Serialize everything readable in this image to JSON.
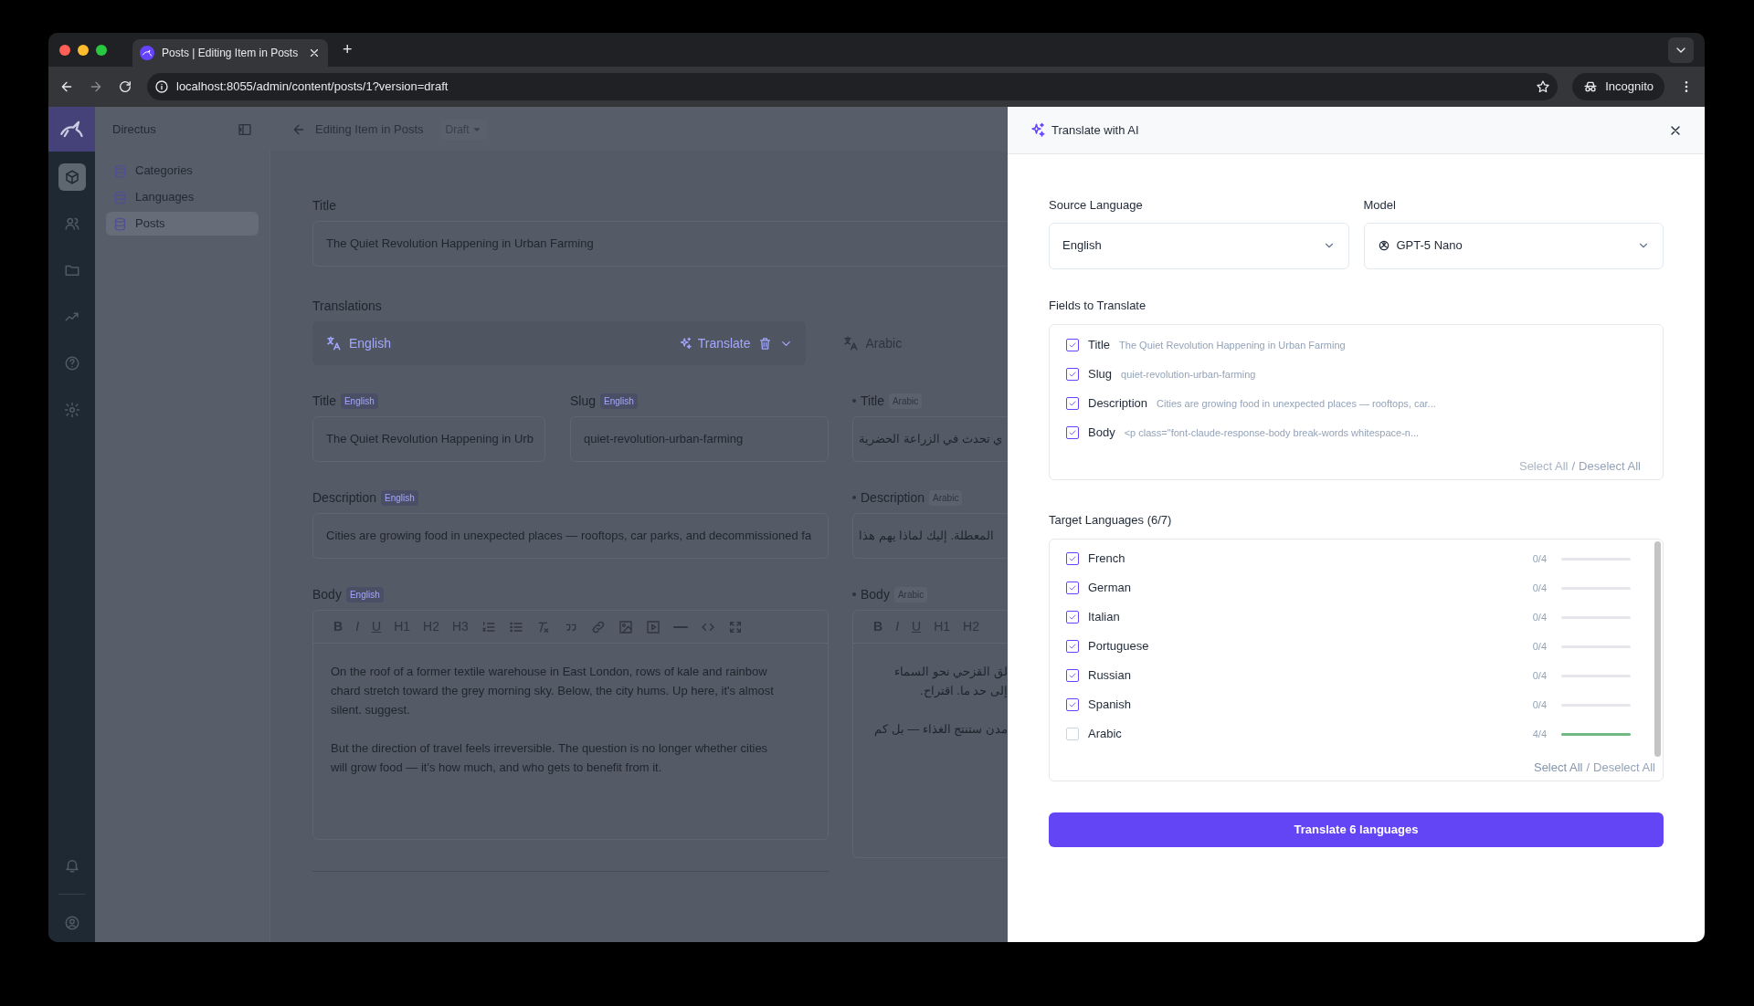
{
  "browser": {
    "tab_title": "Posts | Editing Item in Posts",
    "new_tab": "+",
    "url": "localhost:8055/admin/content/posts/1?version=draft",
    "profile": "Incognito"
  },
  "nav_rail": {
    "items": [
      {
        "selected": true
      },
      {
        "selected": false
      },
      {
        "selected": false
      },
      {
        "selected": false
      },
      {
        "selected": false
      },
      {
        "selected": false
      }
    ]
  },
  "sidebar": {
    "title": "Directus",
    "items": [
      {
        "label": "Categories",
        "selected": false
      },
      {
        "label": "Languages",
        "selected": false
      },
      {
        "label": "Posts",
        "selected": true
      }
    ]
  },
  "header": {
    "title": "Editing Item in Posts",
    "status": "Draft"
  },
  "form": {
    "title_field": {
      "label": "Title",
      "value": "The Quiet Revolution Happening in Urban Farming"
    },
    "translations": {
      "label": "Translations",
      "primary": {
        "language": "English",
        "action": "Translate"
      },
      "secondary": {
        "language": "Arabic"
      }
    },
    "english": {
      "title": {
        "label": "Title",
        "badge": "English",
        "value": "The Quiet Revolution Happening in Urb"
      },
      "slug": {
        "label": "Slug",
        "badge": "English",
        "value": "quiet-revolution-urban-farming"
      },
      "description": {
        "label": "Description",
        "badge": "English",
        "value": "Cities are growing food in unexpected places — rooftops, car parks, and decommissioned fa"
      },
      "body": {
        "label": "Body",
        "badge": "English",
        "toolbar": [
          {
            "kind": "bold",
            "label": "B"
          },
          {
            "kind": "italic",
            "label": "I"
          },
          {
            "kind": "underline",
            "label": "U"
          },
          {
            "kind": "text",
            "label": "H1"
          },
          {
            "kind": "text",
            "label": "H2"
          },
          {
            "kind": "text",
            "label": "H3"
          }
        ],
        "paragraphs": [
          [
            "On the roof of a former textile warehouse in East London, rows of kale and rainbow",
            "chard stretch toward the grey morning sky. Below, the city hums. Up here, it's almost",
            "silent. suggest."
          ],
          [
            "But the direction of travel feels irreversible. The question is no longer whether cities",
            "will grow food — it's how much, and who gets to benefit from it."
          ]
        ]
      }
    },
    "arabic": {
      "modified": true,
      "title": {
        "label": "Title",
        "badge": "Arabic",
        "value": "ي تحدث في الزراعة الحضرية"
      },
      "description": {
        "label": "Description",
        "badge": "Arabic",
        "value": "المعطلة. إليك لماذا يهم هذا"
      },
      "body": {
        "label": "Body",
        "badge": "Arabic",
        "toolbar": [
          {
            "kind": "bold",
            "label": "B"
          },
          {
            "kind": "italic",
            "label": "I"
          },
          {
            "kind": "underline",
            "label": "U"
          },
          {
            "kind": "text",
            "label": "H1"
          },
          {
            "kind": "text",
            "label": "H2"
          }
        ],
        "paragraphs": [
          [
            "لق القزحي نحو السماء",
            "إلى حد ما. اقتراح."
          ],
          [
            "مدن ستنتج الغذاء — بل كم"
          ]
        ]
      }
    }
  },
  "drawer": {
    "title": "Translate with AI",
    "source": {
      "label": "Source Language",
      "value": "English"
    },
    "model": {
      "label": "Model",
      "value": "GPT-5 Nano"
    },
    "fields": {
      "label": "Fields to Translate",
      "items": [
        {
          "label": "Title",
          "preview": "The Quiet Revolution Happening in Urban Farming",
          "checked": true
        },
        {
          "label": "Slug",
          "preview": "quiet-revolution-urban-farming",
          "checked": true
        },
        {
          "label": "Description",
          "preview": "Cities are growing food in unexpected places — rooftops, car...",
          "checked": true
        },
        {
          "label": "Body",
          "preview": "<p class=\"font-claude-response-body break-words whitespace-n...",
          "checked": true
        }
      ],
      "select_all": {
        "label": "Select All",
        "disabled": true
      },
      "separator": "/",
      "deselect_all": {
        "label": "Deselect All",
        "disabled": false
      }
    },
    "targets": {
      "label": "Target Languages (6/7)",
      "items": [
        {
          "label": "French",
          "checked": true,
          "count": "0/4",
          "level": 0
        },
        {
          "label": "German",
          "checked": true,
          "count": "0/4",
          "level": 0
        },
        {
          "label": "Italian",
          "checked": true,
          "count": "0/4",
          "level": 0
        },
        {
          "label": "Portuguese",
          "checked": true,
          "count": "0/4",
          "level": 0
        },
        {
          "label": "Russian",
          "checked": true,
          "count": "0/4",
          "level": 0
        },
        {
          "label": "Spanish",
          "checked": true,
          "count": "0/4",
          "level": 0
        },
        {
          "label": "Arabic",
          "checked": false,
          "count": "4/4",
          "level": 1
        }
      ],
      "select_all": {
        "label": "Select All",
        "disabled": false
      },
      "separator": "/",
      "deselect_all": {
        "label": "Deselect All",
        "disabled": false
      }
    },
    "submit": "Translate 6 languages"
  }
}
